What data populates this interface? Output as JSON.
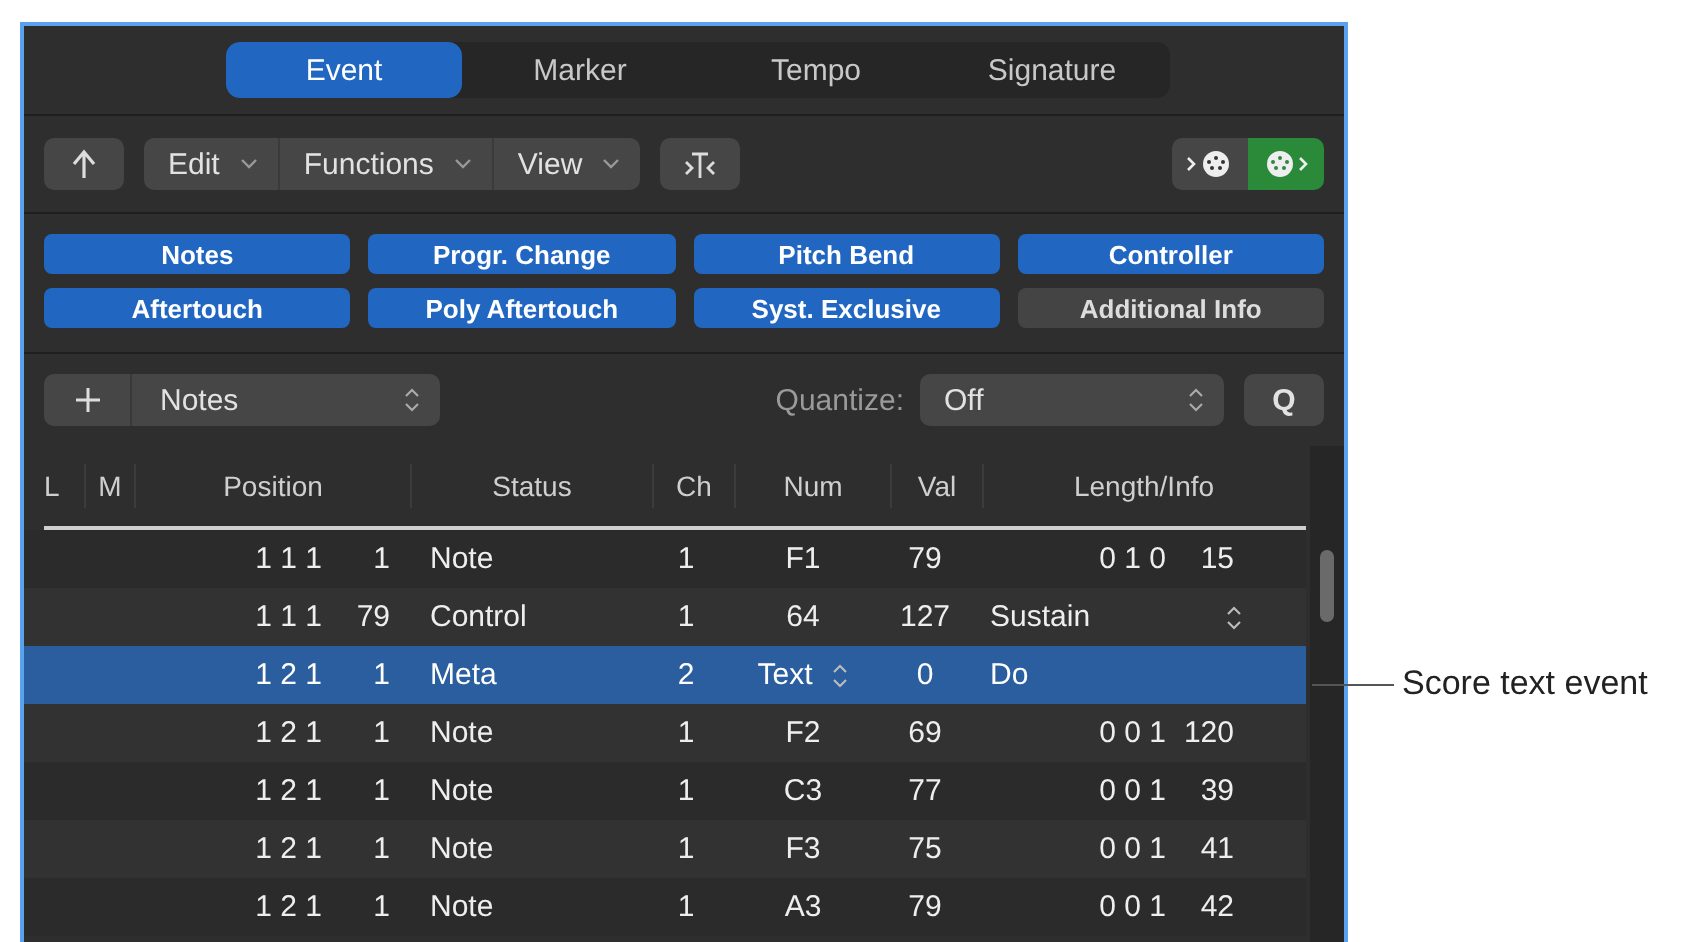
{
  "tabs": [
    {
      "label": "Event",
      "selected": true
    },
    {
      "label": "Marker",
      "selected": false
    },
    {
      "label": "Tempo",
      "selected": false
    },
    {
      "label": "Signature",
      "selected": false
    }
  ],
  "toolbar": {
    "menus": [
      "Edit",
      "Functions",
      "View"
    ],
    "midi_in": {
      "on": false
    },
    "midi_out": {
      "on": true
    }
  },
  "filters": [
    {
      "label": "Notes",
      "on": true
    },
    {
      "label": "Progr. Change",
      "on": true
    },
    {
      "label": "Pitch Bend",
      "on": true
    },
    {
      "label": "Controller",
      "on": true
    },
    {
      "label": "Aftertouch",
      "on": true
    },
    {
      "label": "Poly Aftertouch",
      "on": true
    },
    {
      "label": "Syst. Exclusive",
      "on": true
    },
    {
      "label": "Additional Info",
      "on": false
    }
  ],
  "create": {
    "type": "Notes"
  },
  "quantize": {
    "label": "Quantize:",
    "value": "Off",
    "button": "Q"
  },
  "table": {
    "columns": [
      "L",
      "M",
      "Position",
      "Status",
      "Ch",
      "Num",
      "Val",
      "Length/Info"
    ],
    "rows": [
      {
        "kind": "note",
        "position": "1 1 1",
        "tick": "1",
        "status": "Note",
        "ch": "1",
        "num": "F1",
        "val": "79",
        "length": "0 1 0",
        "ticks": "15",
        "selected": false
      },
      {
        "kind": "control",
        "position": "1 1 1",
        "tick": "79",
        "status": "Control",
        "ch": "1",
        "num": "64",
        "val": "127",
        "info": "Sustain",
        "info_popup": true,
        "selected": false
      },
      {
        "kind": "meta",
        "position": "1 2 1",
        "tick": "1",
        "status": "Meta",
        "ch": "2",
        "num": "Text",
        "num_popup": true,
        "val": "0",
        "info": "Do",
        "info_popup": false,
        "selected": true
      },
      {
        "kind": "note",
        "position": "1 2 1",
        "tick": "1",
        "status": "Note",
        "ch": "1",
        "num": "F2",
        "val": "69",
        "length": "0 0 1",
        "ticks": "120",
        "selected": false
      },
      {
        "kind": "note",
        "position": "1 2 1",
        "tick": "1",
        "status": "Note",
        "ch": "1",
        "num": "C3",
        "val": "77",
        "length": "0 0 1",
        "ticks": "39",
        "selected": false
      },
      {
        "kind": "note",
        "position": "1 2 1",
        "tick": "1",
        "status": "Note",
        "ch": "1",
        "num": "F3",
        "val": "75",
        "length": "0 0 1",
        "ticks": "41",
        "selected": false
      },
      {
        "kind": "note",
        "position": "1 2 1",
        "tick": "1",
        "status": "Note",
        "ch": "1",
        "num": "A3",
        "val": "79",
        "length": "0 0 1",
        "ticks": "42",
        "selected": false
      }
    ]
  },
  "callout": "Score text event"
}
